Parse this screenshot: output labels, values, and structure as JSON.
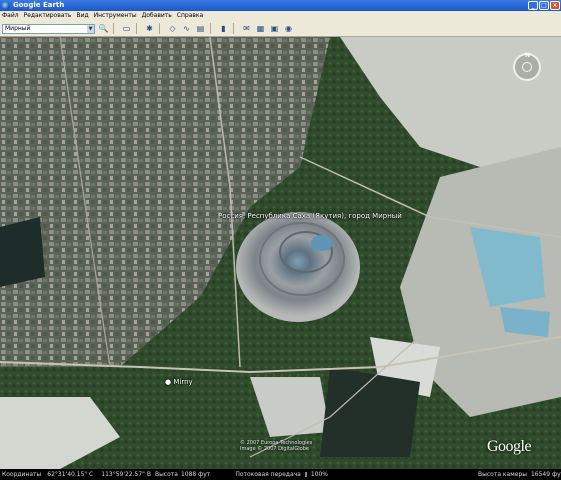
{
  "window": {
    "title": "Google Earth"
  },
  "menu": {
    "items": [
      "Файл",
      "Редактировать",
      "Вид",
      "Инструменты",
      "Добавить",
      "Справка"
    ]
  },
  "toolbar": {
    "search_value": "Мирный",
    "icons": [
      "search-go-icon",
      "sidebar-toggle-icon",
      "placemark-icon",
      "polygon-icon",
      "path-icon",
      "overlay-icon",
      "ruler-icon",
      "email-icon",
      "print-icon",
      "maps-icon",
      "sky-icon"
    ]
  },
  "map": {
    "place_label": "Россия, Республика Саха (Якутия), город Мирный",
    "town_label": "Mirny",
    "credits": [
      "© 2007 Europa Technologies",
      "Image © 2007 DigitalGlobe"
    ],
    "logo": "Google",
    "nav_north": "N"
  },
  "status": {
    "coords_label": "Координаты",
    "coords_value": "62°31'40.15\" С",
    "lon_value": "113°59'22.57\" В",
    "elev_label": "Высота",
    "elev_value": "1088 фут",
    "streaming_label": "Потоковая передача",
    "streaming_value": "100%",
    "streaming_fraction": 1.0,
    "eye_label": "Высота камеры",
    "eye_value": "16549 фут"
  },
  "colors": {
    "titlebar": "#245edb",
    "chrome": "#ece9d8",
    "status_bg": "#000000"
  }
}
